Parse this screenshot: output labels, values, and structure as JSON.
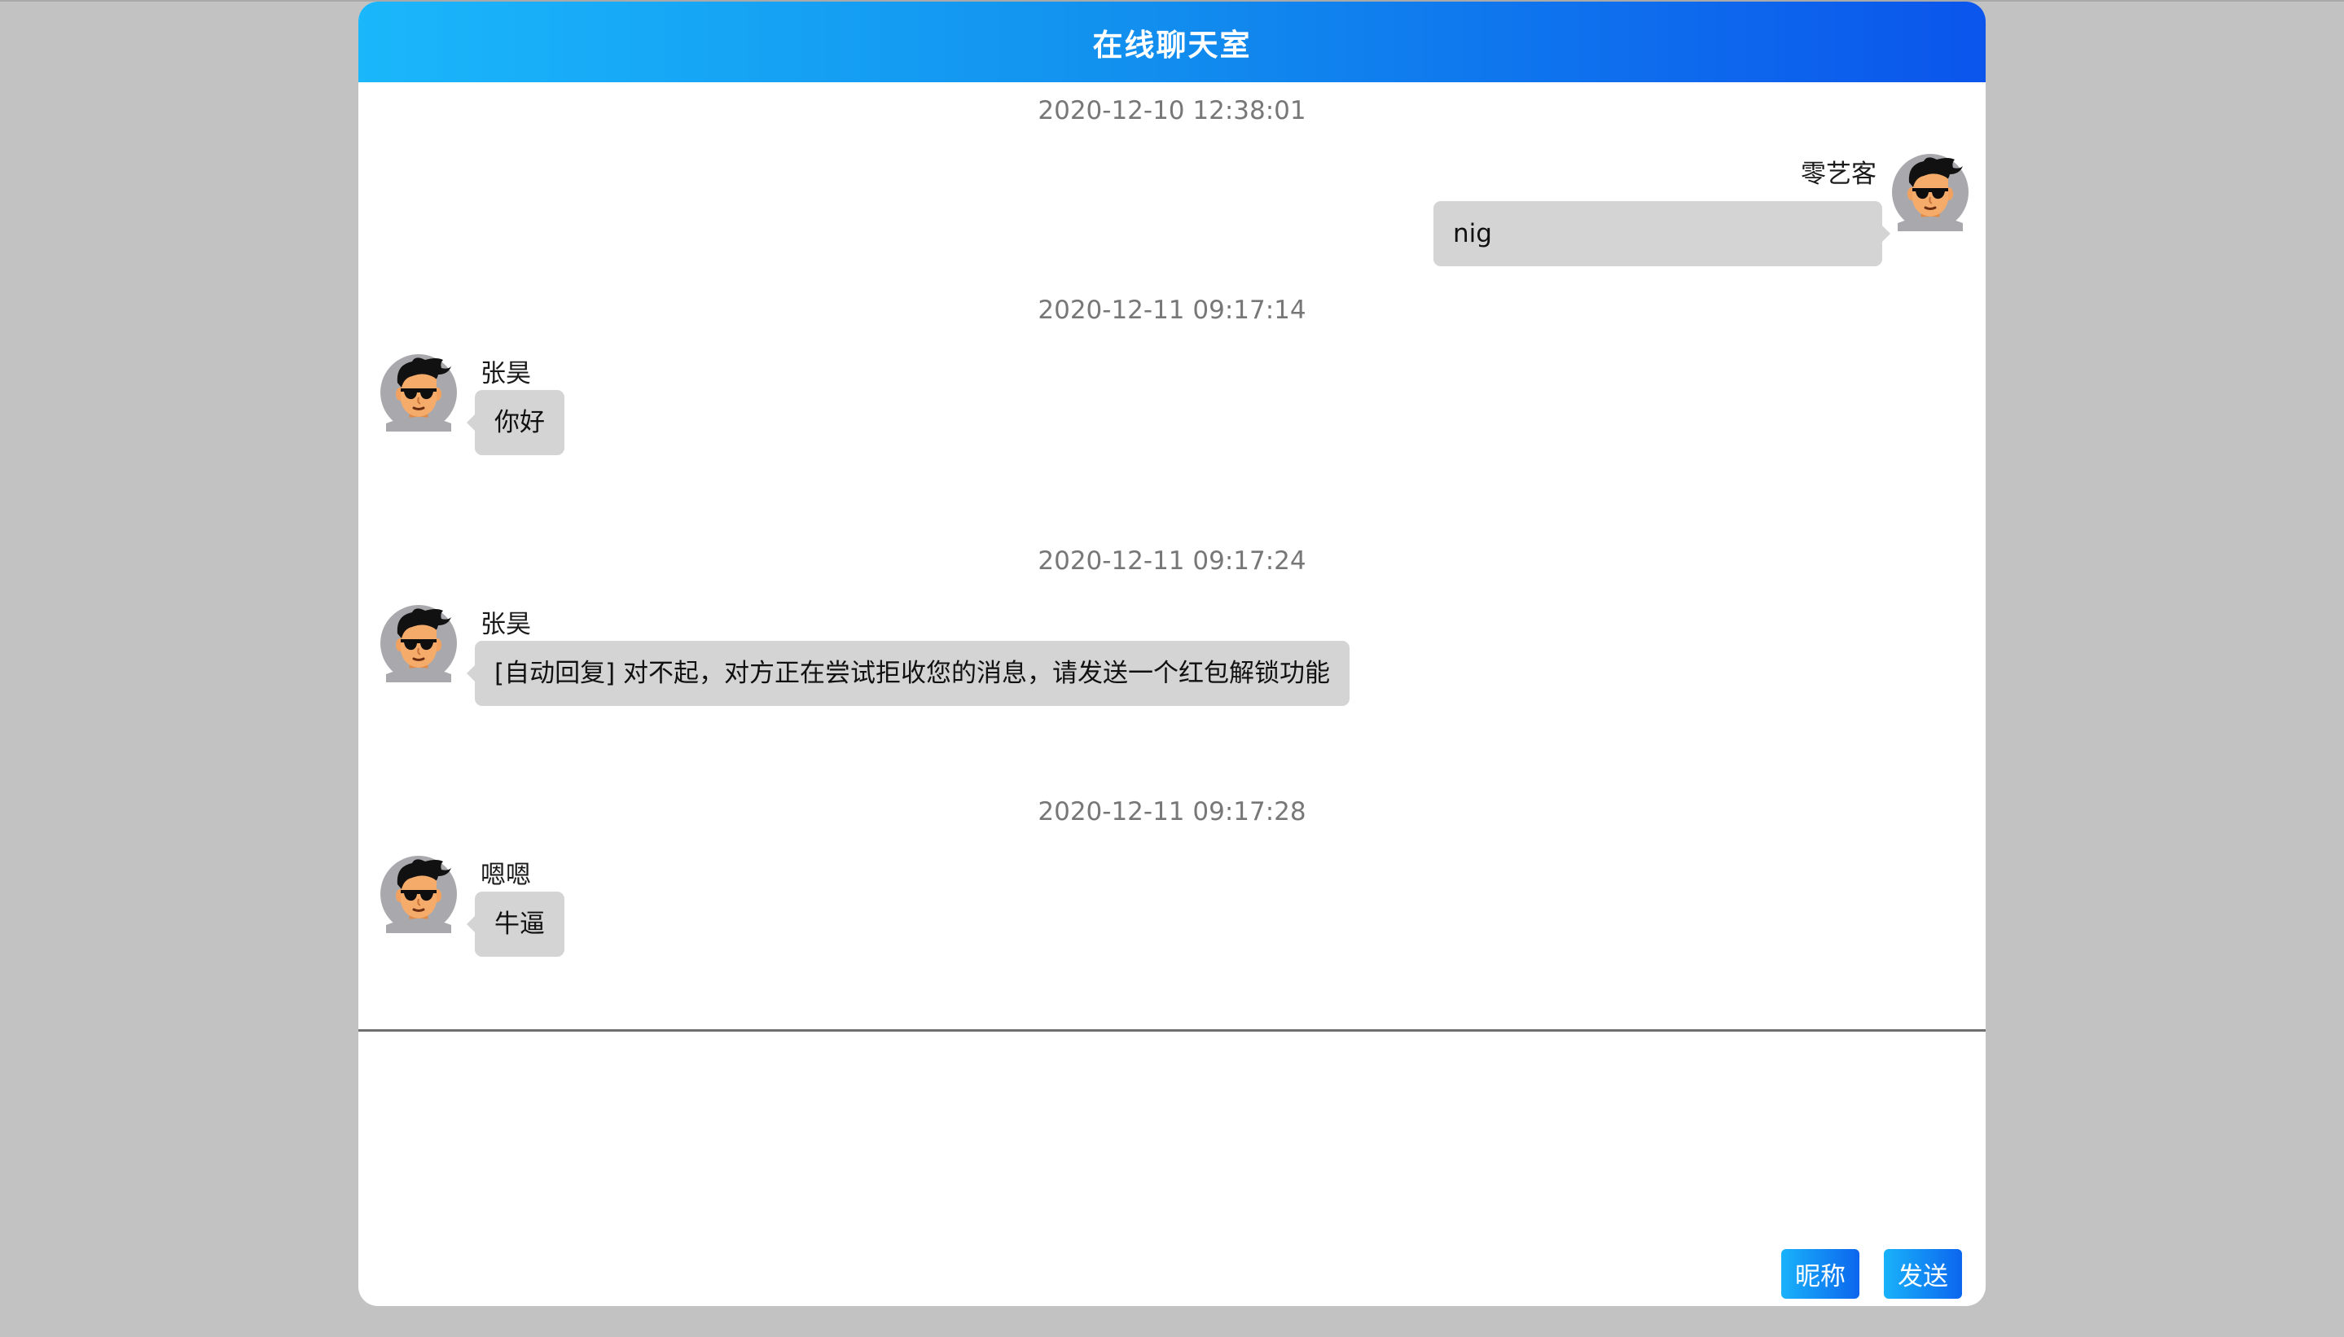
{
  "header": {
    "title": "在线聊天室"
  },
  "messages": [
    {
      "time": "2020-12-10 12:38:01",
      "side": "right",
      "nick": "零艺客",
      "text": "nig"
    },
    {
      "time": "2020-12-11 09:17:14",
      "side": "left",
      "nick": "张昊",
      "text": "你好"
    },
    {
      "time": "2020-12-11 09:17:24",
      "side": "left",
      "nick": "张昊",
      "text": "[自动回复] 对不起，对方正在尝试拒收您的消息，请发送一个红包解锁功能"
    },
    {
      "time": "2020-12-11 09:17:28",
      "side": "left",
      "nick": "嗯嗯",
      "text": "牛逼"
    }
  ],
  "footer": {
    "nickname_button": "昵称",
    "send_button": "发送",
    "input_value": ""
  },
  "icons": {
    "avatar": "avatar-icon"
  },
  "colors": {
    "header_gradient_start": "#1ab7fb",
    "header_gradient_end": "#0b55ec",
    "bubble": "#d4d4d4",
    "page_background": "#c2c2c2"
  }
}
